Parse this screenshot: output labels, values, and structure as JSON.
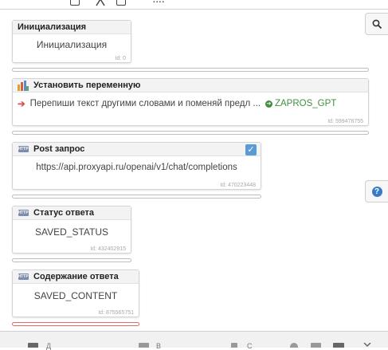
{
  "toolbar": {
    "dots": "...."
  },
  "nodes": [
    {
      "title": "Инициализация",
      "body": "Инициализация",
      "id": "Id: 0"
    },
    {
      "title": "Установить переменную",
      "body": "Перепиши текст другими словами и поменяй предл ...",
      "target": "ZAPROS_GPT",
      "id": "Id: 599478755"
    },
    {
      "title": "Post запрос",
      "body": "https://api.proxyapi.ru/openai/v1/chat/completions",
      "id": "Id: 470223448",
      "checked": true
    },
    {
      "title": "Статус ответа",
      "body": "SAVED_STATUS",
      "id": "Id: 432402915"
    },
    {
      "title": "Содержание ответа",
      "body": "SAVED_CONTENT",
      "id": "Id: 875565751"
    }
  ],
  "icons": {
    "http": "http-icon",
    "variable": "set-variable-icon",
    "search": "search-icon",
    "help": "help-icon",
    "arrow": "arrow-right-icon",
    "goto": "goto-icon",
    "check": "check-icon"
  },
  "bottom": {
    "items": [
      "Д",
      "В",
      "С"
    ]
  },
  "colors": {
    "accent": "#3a7bc8",
    "arrow": "#d9534f",
    "target": "#3f8f3f",
    "error_link": "#e06a6a"
  }
}
